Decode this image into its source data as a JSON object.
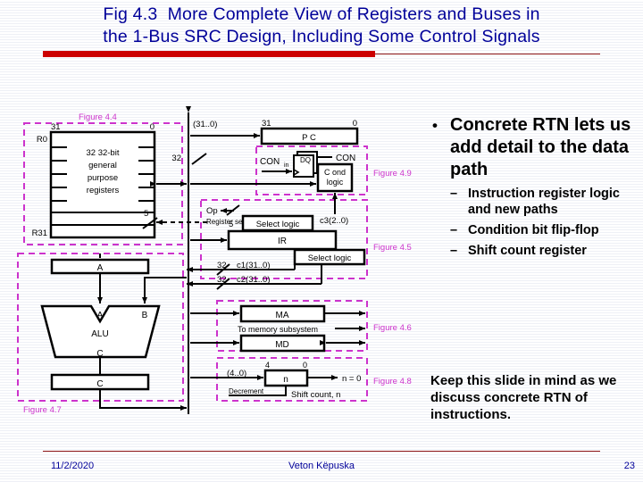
{
  "slide": {
    "title_line1": "Fig 4.3  More Complete View of Registers and Buses in",
    "title_line2": "the 1-Bus SRC Design, Including Some Control Signals",
    "title_color": "#000099",
    "accent_rule_color": "#cc0000",
    "figure_label_color": "#cc33cc"
  },
  "bullets": {
    "main": "Concrete RTN lets us add detail to the data path",
    "sub": [
      "Instruction register logic and new paths",
      "Condition bit flip-flop",
      "Shift count register"
    ],
    "note": "Keep this slide in mind as we discuss concrete RTN of instructions."
  },
  "diagram": {
    "group_labels": {
      "regfile": "Figure 4.4",
      "cond": "Figure 4.9",
      "ir": "Figure 4.5",
      "memory": "Figure 4.6",
      "shift": "Figure 4.8",
      "alu": "Figure 4.7"
    },
    "regfile": {
      "top_left_bit": "31",
      "top_right_bit": "0",
      "first_reg": "R0",
      "last_reg": "R31",
      "caption_line1": "32 32-bit",
      "caption_line2": "general",
      "caption_line3": "purpose",
      "caption_line4": "registers",
      "select_width": "5"
    },
    "bus": {
      "label": "(31..0)",
      "width_32": "32"
    },
    "pc": {
      "label": "P C",
      "bit_high": "31",
      "bit_low": "0"
    },
    "cond": {
      "con_in": "CON",
      "con_in_sub": "in",
      "ff_d": "D",
      "ff_q": "Q",
      "con_out": "CON",
      "logic_line1": "C ond",
      "logic_line2": "logic",
      "c3": "c3(2..0)"
    },
    "ir": {
      "op": "Op",
      "register_select": "Register select",
      "select_width": "5",
      "select_logic_top": "Select logic",
      "select_logic_bottom": "Select logic",
      "ir_label": "IR",
      "c1_width": "32",
      "c1": "c1(31..0)",
      "c2_width": "32",
      "c2": "c2(31..0)"
    },
    "alu": {
      "a_reg": "A",
      "a_port": "A",
      "b_port": "B",
      "name": "ALU",
      "c_port": "C",
      "c_reg": "C"
    },
    "memory": {
      "ma": "MA",
      "to_memory": "To memory subsystem",
      "md": "MD"
    },
    "shift": {
      "range": "(4..0)",
      "bit_high": "4",
      "bit_low": "0",
      "reg": "n",
      "zero_test": "n = 0",
      "decrement": "Decrement",
      "caption": "Shift count, n"
    }
  },
  "footer": {
    "date": "11/2/2020",
    "author": "Veton Këpuska",
    "page": "23"
  }
}
